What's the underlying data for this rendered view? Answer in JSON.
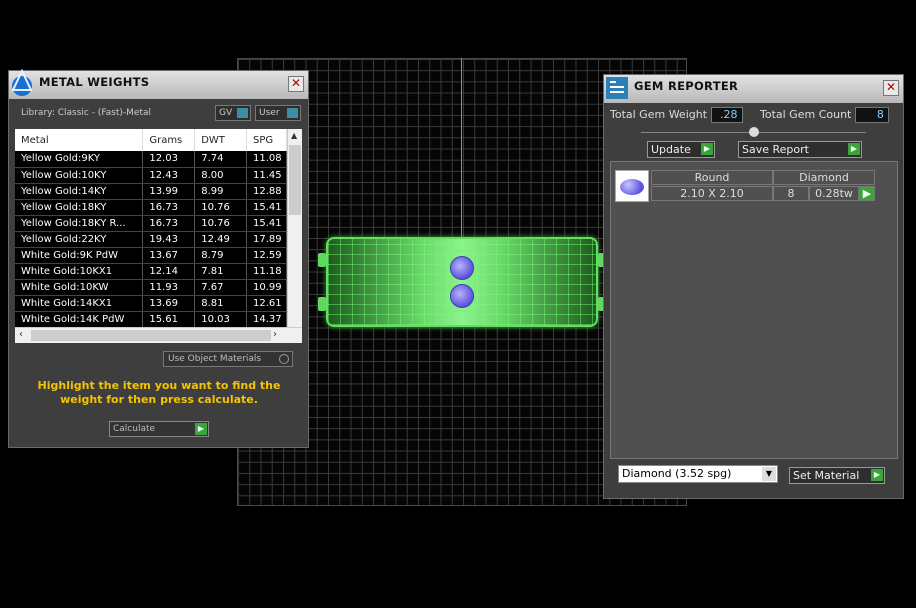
{
  "metal_weights": {
    "title": "METAL WEIGHTS",
    "library_label": "Library: Classic - (Fast)-Metal",
    "gv_label": "GV",
    "user_label": "User",
    "columns": [
      "Metal",
      "Grams",
      "DWT",
      "SPG"
    ],
    "rows": [
      [
        "Yellow Gold:9KY",
        "12.03",
        "7.74",
        "11.08"
      ],
      [
        "Yellow Gold:10KY",
        "12.43",
        "8.00",
        "11.45"
      ],
      [
        "Yellow Gold:14KY",
        "13.99",
        "8.99",
        "12.88"
      ],
      [
        "Yellow Gold:18KY",
        "16.73",
        "10.76",
        "15.41"
      ],
      [
        "Yellow Gold:18KY R...",
        "16.73",
        "10.76",
        "15.41"
      ],
      [
        "Yellow Gold:22KY",
        "19.43",
        "12.49",
        "17.89"
      ],
      [
        "White Gold:9K PdW",
        "13.67",
        "8.79",
        "12.59"
      ],
      [
        "White Gold:10KX1",
        "12.14",
        "7.81",
        "11.18"
      ],
      [
        "White Gold:10KW",
        "11.93",
        "7.67",
        "10.99"
      ],
      [
        "White Gold:14KX1",
        "13.69",
        "8.81",
        "12.61"
      ],
      [
        "White Gold:14K PdW",
        "15.61",
        "10.03",
        "14.37"
      ]
    ],
    "use_object_materials": "Use Object Materials",
    "hint": "Highlight the item you want to find the weight for then press calculate.",
    "calculate_label": "Calculate"
  },
  "gem_reporter": {
    "title": "GEM REPORTER",
    "total_weight_label": "Total Gem Weight",
    "total_weight_value": ".28",
    "total_count_label": "Total Gem Count",
    "total_count_value": "8",
    "update_label": "Update",
    "save_report_label": "Save Report",
    "gem": {
      "shape": "Round",
      "material": "Diamond",
      "size": "2.10 X 2.10",
      "count": "8",
      "weight": "0.28tw"
    },
    "material_select": "Diamond    (3.52 spg)",
    "set_material_label": "Set Material"
  }
}
